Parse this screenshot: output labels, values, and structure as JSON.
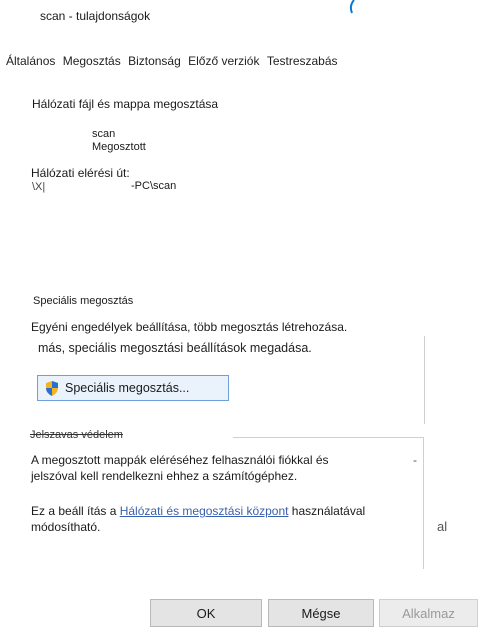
{
  "window": {
    "title": "scan - tulajdonságok"
  },
  "tabs": [
    "Általános",
    "Megosztás",
    "Biztonság",
    "Előző verziók",
    "Testreszabás"
  ],
  "network_sharing": {
    "heading": "Hálózati fájl és mappa megosztása",
    "share_name": "scan",
    "share_state": "Megosztott"
  },
  "network_path": {
    "label": "Hálózati elérési út:",
    "prefix": "\\X|",
    "suffix": "-PC\\scan"
  },
  "advanced_sharing": {
    "heading": "Speciális megosztás",
    "description": "Egyéni engedélyek beállítása, több megosztás létrehozása.",
    "description_cont": "más, speciális megosztási beállítások megadása.",
    "button_label": "Speciális megosztás..."
  },
  "password_protection": {
    "heading": "Jelszavas védelem",
    "line1": "A megosztott mappák eléréséhez felhasználói fiókkal és",
    "line2": "jelszóval kell rendelkezni ehhez a számítógéphez.",
    "line3_before": "Ez a beáll ítás a ",
    "line3_link": "Hálózati és megosztási központ",
    "line3_after": " használatával",
    "line4": "módosítható."
  },
  "buttons": {
    "ok": "OK",
    "cancel": "Mégse",
    "apply": "Alkalmaz"
  },
  "colors": {
    "accent_blue": "#0a78d7",
    "link": "#3a5fae",
    "button_border_focus": "#6f9fd8"
  },
  "icons": {
    "shield": "uac-shield-icon"
  }
}
